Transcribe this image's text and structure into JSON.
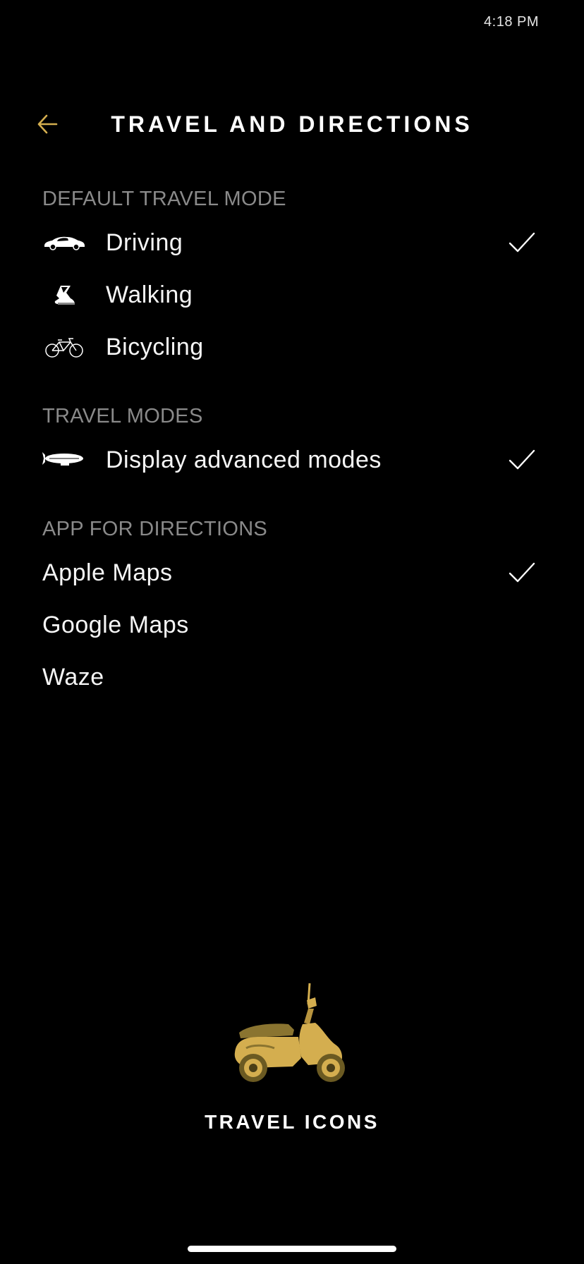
{
  "status": {
    "time": "4:18 PM"
  },
  "header": {
    "title": "TRAVEL AND DIRECTIONS",
    "back_icon": "arrow-left-icon"
  },
  "colors": {
    "accent": "#d4ae4f",
    "background": "#000000",
    "section": "#8a8a8a"
  },
  "sections": {
    "default_mode": {
      "heading": "DEFAULT TRAVEL MODE",
      "items": [
        {
          "label": "Driving",
          "icon": "car-icon",
          "selected": true
        },
        {
          "label": "Walking",
          "icon": "shoe-icon",
          "selected": false
        },
        {
          "label": "Bicycling",
          "icon": "bicycle-icon",
          "selected": false
        }
      ]
    },
    "travel_modes": {
      "heading": "TRAVEL MODES",
      "items": [
        {
          "label": "Display advanced modes",
          "icon": "blimp-icon",
          "selected": true
        }
      ]
    },
    "directions_app": {
      "heading": "APP FOR DIRECTIONS",
      "items": [
        {
          "label": "Apple Maps",
          "selected": true
        },
        {
          "label": "Google Maps",
          "selected": false
        },
        {
          "label": "Waze",
          "selected": false
        }
      ]
    }
  },
  "promo": {
    "label": "TRAVEL ICONS",
    "icon": "scooter-icon"
  }
}
